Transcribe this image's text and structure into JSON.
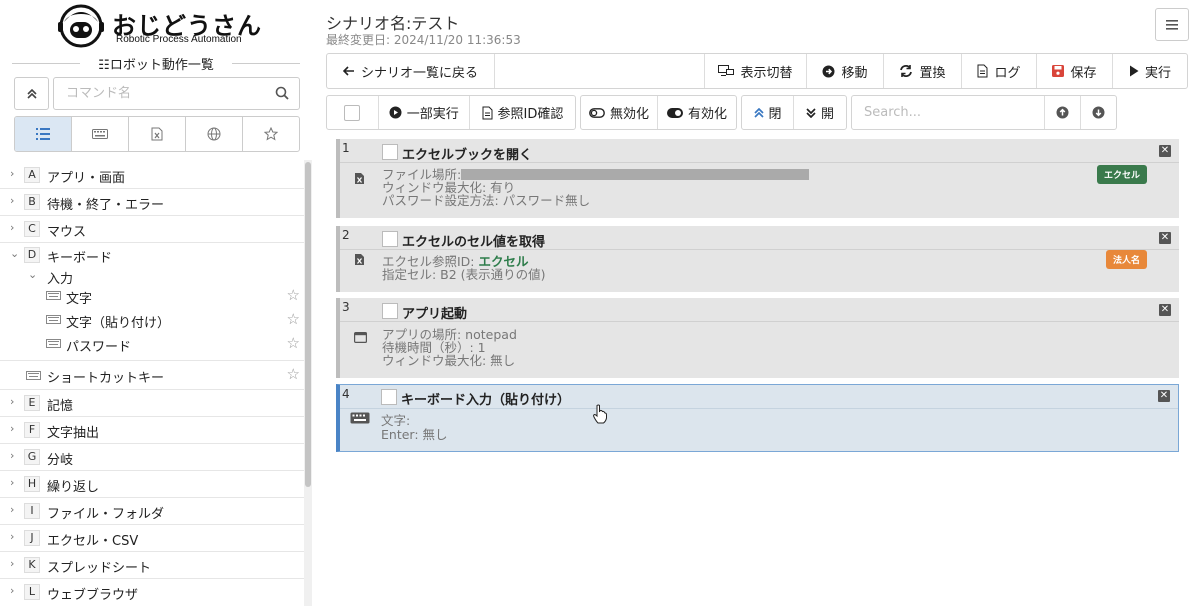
{
  "app": {
    "brand": "おじどうさん",
    "tagline": "Robotic Process Automation"
  },
  "sidebar": {
    "header": "☷ロボット動作一覧",
    "search_placeholder": "コマンド名",
    "tabs": [
      {
        "name": "list-icon",
        "active": true
      },
      {
        "name": "keyboard-icon",
        "active": false
      },
      {
        "name": "excel-icon",
        "active": false
      },
      {
        "name": "globe-icon",
        "active": false
      },
      {
        "name": "star-icon",
        "active": false
      }
    ],
    "tree": [
      {
        "letter": "A",
        "label": "アプリ・画面",
        "expanded": false
      },
      {
        "letter": "B",
        "label": "待機・終了・エラー",
        "expanded": false
      },
      {
        "letter": "C",
        "label": "マウス",
        "expanded": false
      },
      {
        "letter": "D",
        "label": "キーボード",
        "expanded": true
      },
      {
        "sub": "入力"
      },
      {
        "leaf": "文字"
      },
      {
        "leaf": "文字（貼り付け）"
      },
      {
        "leaf": "パスワード"
      },
      {
        "leaf2": "ショートカットキー"
      },
      {
        "letter": "E",
        "label": "記憶",
        "expanded": false
      },
      {
        "letter": "F",
        "label": "文字抽出",
        "expanded": false
      },
      {
        "letter": "G",
        "label": "分岐",
        "expanded": false
      },
      {
        "letter": "H",
        "label": "繰り返し",
        "expanded": false
      },
      {
        "letter": "I",
        "label": "ファイル・フォルダ",
        "expanded": false
      },
      {
        "letter": "J",
        "label": "エクセル・CSV",
        "expanded": false
      },
      {
        "letter": "K",
        "label": "スプレッドシート",
        "expanded": false
      },
      {
        "letter": "L",
        "label": "ウェブブラウザ",
        "expanded": false
      }
    ]
  },
  "header": {
    "scenario_title": "シナリオ名:テスト",
    "updated": "最終変更日: 2024/11/20 11:36:53"
  },
  "toolbar1": {
    "back": "シナリオ一覧に戻る",
    "toggle_view": "表示切替",
    "move": "移動",
    "replace": "置換",
    "log": "ログ",
    "save": "保存",
    "run": "実行"
  },
  "toolbar2": {
    "partial_run": "一部実行",
    "ref_id_check": "参照ID確認",
    "disable": "無効化",
    "enable": "有効化",
    "close": "閉",
    "open": "開",
    "search_placeholder": "Search..."
  },
  "steps": [
    {
      "num": "1",
      "title": "エクセルブックを開く",
      "details": [
        "ファイル場所:",
        "ウィンドウ最大化: 有り",
        "パスワード設定方法: パスワード無し"
      ],
      "badge": "エクセル",
      "badge_color": "#3a7a4c"
    },
    {
      "num": "2",
      "title": "エクセルのセル値を取得",
      "details_ref_label": "エクセル参照ID: ",
      "details_ref_value": "エクセル",
      "details": [
        "指定セル: B2 (表示通りの値)"
      ],
      "badge": "法人名",
      "badge_color": "#e8883a"
    },
    {
      "num": "3",
      "title": "アプリ起動",
      "details": [
        "アプリの場所: notepad",
        "待機時間（秒）: 1",
        "ウィンドウ最大化: 無し"
      ]
    },
    {
      "num": "4",
      "title": "キーボード入力（貼り付け）",
      "details": [
        "文字:",
        "Enter: 無し"
      ]
    }
  ]
}
